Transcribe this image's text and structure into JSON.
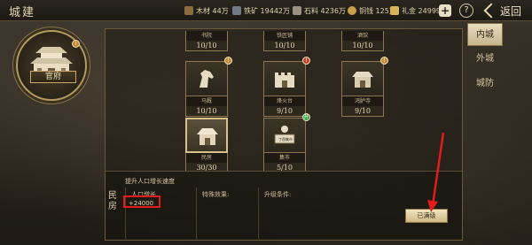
{
  "header": {
    "title": "城建",
    "resources": [
      {
        "name": "木材",
        "value": "44万",
        "color": "#8b6b3e",
        "icon": "wood-icon"
      },
      {
        "name": "铁矿",
        "value": "19442万",
        "color": "#6f7a84",
        "icon": "iron-ore-icon"
      },
      {
        "name": "石料",
        "value": "4236万",
        "color": "#9a9181",
        "icon": "stone-icon"
      },
      {
        "name": "铜钱",
        "value": "125万",
        "color": "#c9a04a",
        "icon": "coin-icon"
      },
      {
        "name": "礼金",
        "value": "24999",
        "color": "#d9b35a",
        "icon": "gift-money-icon"
      }
    ],
    "plus_label": "+",
    "help_label": "?",
    "back_label": "返回"
  },
  "emblem": {
    "name": "官府",
    "level": "",
    "badge": "!"
  },
  "buildings": {
    "row_top": [
      {
        "name": "书院",
        "level": "10/10"
      },
      {
        "name": "铁匠铺",
        "level": "10/10"
      },
      {
        "name": "酒馆",
        "level": "10/10"
      }
    ],
    "row_mid": [
      {
        "name": "马厩",
        "level": "10/10",
        "badge": "!",
        "badge_color": "orange"
      },
      {
        "name": "烽火台",
        "level": "9/10",
        "badge": "!",
        "badge_color": "red"
      },
      {
        "name": "鸿胪寺",
        "level": "9/10",
        "badge": "!",
        "badge_color": "orange"
      }
    ],
    "row_bottom": [
      {
        "name": "民房",
        "level": "30/30",
        "selected": true
      },
      {
        "name": "集市",
        "level": "5/10",
        "badge": "升",
        "badge_color": "green",
        "plaque": "丁酉集市"
      }
    ]
  },
  "detail": {
    "side_word": "民房",
    "hint": "提升人口增长速度",
    "col1_label": "人口增长",
    "col2_label": "特殊效果:",
    "col3_label": "升级条件:",
    "value": "+24000",
    "button_label": "已满级"
  },
  "tabs": [
    {
      "label": "内城",
      "active": true
    },
    {
      "label": "外城",
      "active": false
    },
    {
      "label": "城防",
      "active": false
    }
  ]
}
